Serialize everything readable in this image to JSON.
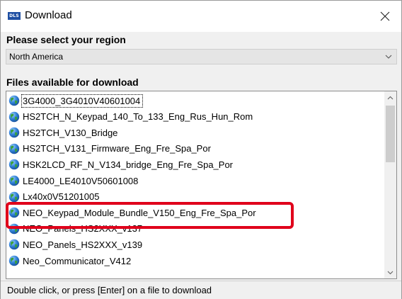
{
  "window": {
    "title": "Download",
    "logo_text": "DLS"
  },
  "region": {
    "heading": "Please select your region",
    "selected": "North America"
  },
  "files": {
    "heading": "Files available for download",
    "items": [
      "3G4000_3G4010V40601004",
      "HS2TCH_N_Keypad_140_To_133_Eng_Rus_Hun_Rom",
      "HS2TCH_V130_Bridge",
      "HS2TCH_V131_Firmware_Eng_Fre_Spa_Por",
      "HSK2LCD_RF_N_V134_bridge_Eng_Fre_Spa_Por",
      "LE4000_LE4010V50601008",
      "Lx40x0V51201005",
      "NEO_Keypad_Module_Bundle_V150_Eng_Fre_Spa_Por",
      "NEO_Panels_HS2XXX_v137",
      "NEO_Panels_HS2XXX_v139",
      "Neo_Communicator_V412"
    ],
    "focused_index": 0,
    "highlighted_index": 7
  },
  "status": {
    "text": "Double click, or press [Enter] on a file to download"
  },
  "icons": {
    "item_icon": "globe-icon",
    "close": "close-icon",
    "dropdown": "chevron-down-icon"
  },
  "colors": {
    "highlight_border": "#e0001b",
    "logo_bg": "#1f4fa3"
  }
}
